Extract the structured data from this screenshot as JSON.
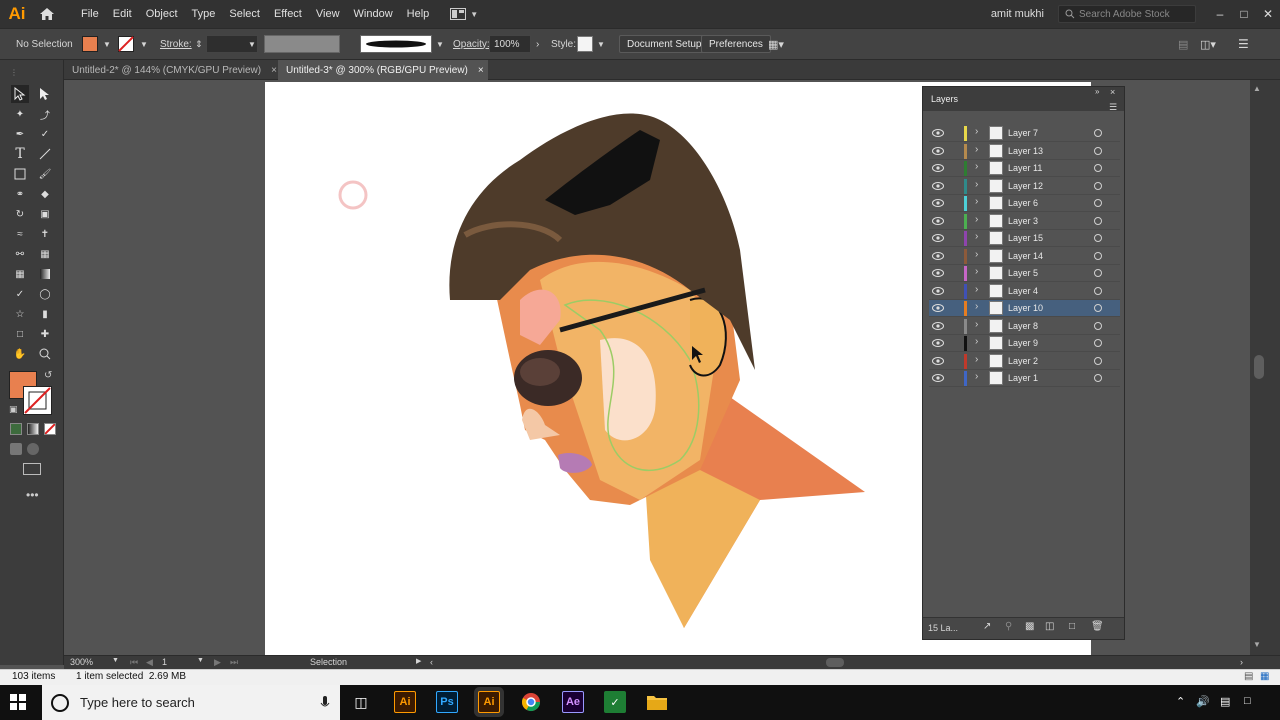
{
  "app": {
    "logo": "Ai",
    "user": "amit mukhi",
    "search_placeholder": "Search Adobe Stock"
  },
  "menu": [
    "File",
    "Edit",
    "Object",
    "Type",
    "Select",
    "Effect",
    "View",
    "Window",
    "Help"
  ],
  "window_controls": {
    "minimize": "–",
    "maximize": "□",
    "close": "✕"
  },
  "control_bar": {
    "selection": "No Selection",
    "stroke_label": "Stroke:",
    "opacity_label": "Opacity:",
    "opacity_value": "100%",
    "style_label": "Style:",
    "document_setup": "Document Setup",
    "preferences": "Preferences",
    "fill_color": "#e8804f"
  },
  "tabs": [
    {
      "label": "Untitled-2* @ 144% (CMYK/GPU Preview)"
    },
    {
      "label": "Untitled-3* @ 300% (RGB/GPU Preview)"
    }
  ],
  "tab_close": "×",
  "layers_panel": {
    "title": "Layers",
    "footer_count": "15 La...",
    "layers": [
      {
        "name": "Layer 7",
        "color": "#e8d84a"
      },
      {
        "name": "Layer 13",
        "color": "#b58a4e"
      },
      {
        "name": "Layer 11",
        "color": "#2e7d32"
      },
      {
        "name": "Layer 12",
        "color": "#2f8a8a"
      },
      {
        "name": "Layer 6",
        "color": "#4dd0d8"
      },
      {
        "name": "Layer 3",
        "color": "#4caf50"
      },
      {
        "name": "Layer 15",
        "color": "#8e44ad"
      },
      {
        "name": "Layer 14",
        "color": "#8d5a3a"
      },
      {
        "name": "Layer 5",
        "color": "#c766c7"
      },
      {
        "name": "Layer 4",
        "color": "#3f51b5"
      },
      {
        "name": "Layer 10",
        "color": "#e67e22",
        "selected": true
      },
      {
        "name": "Layer 8",
        "color": "#8a8a8a"
      },
      {
        "name": "Layer 9",
        "color": "#111111"
      },
      {
        "name": "Layer 2",
        "color": "#c0392b"
      },
      {
        "name": "Layer 1",
        "color": "#3f66c5"
      }
    ]
  },
  "status_bar": {
    "zoom": "300%",
    "page": "1",
    "tool": "Selection"
  },
  "explorer_status": {
    "items": "103 items",
    "selected": "1 item selected  2.69 MB"
  },
  "taskbar": {
    "search_placeholder": "Type here to search"
  }
}
